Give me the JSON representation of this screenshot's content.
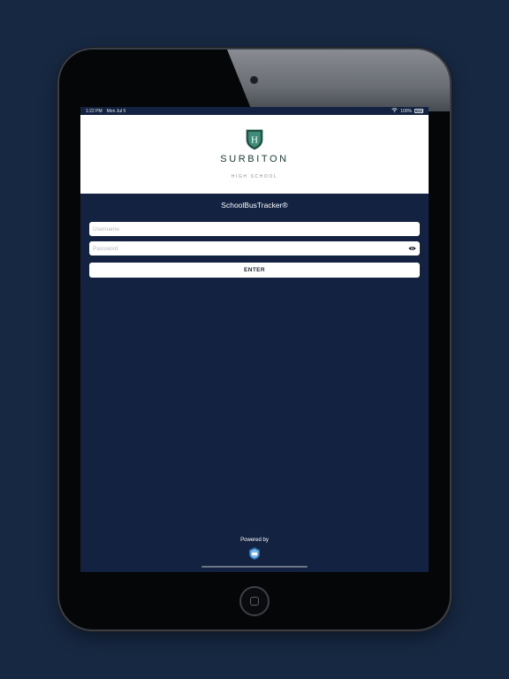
{
  "status_bar": {
    "time": "1:22 PM",
    "date": "Mon Jul 5",
    "battery": "100%"
  },
  "header": {
    "brand": "SURBITON",
    "subtitle": "HIGH SCHOOL",
    "crest_monogram": "H"
  },
  "app": {
    "title": "SchoolBusTracker®"
  },
  "login": {
    "username_placeholder": "Username",
    "password_placeholder": "Password",
    "enter_label": "ENTER"
  },
  "footer": {
    "powered_by": "Powered by"
  },
  "icons": {
    "eye": "eye-icon",
    "wifi": "wifi-icon",
    "battery": "battery-icon",
    "crest": "crest-icon",
    "logo": "powered-by-logo-icon"
  },
  "colors": {
    "background": "#172842",
    "screen": "#122240",
    "brand_green": "#173a34",
    "white": "#ffffff"
  }
}
